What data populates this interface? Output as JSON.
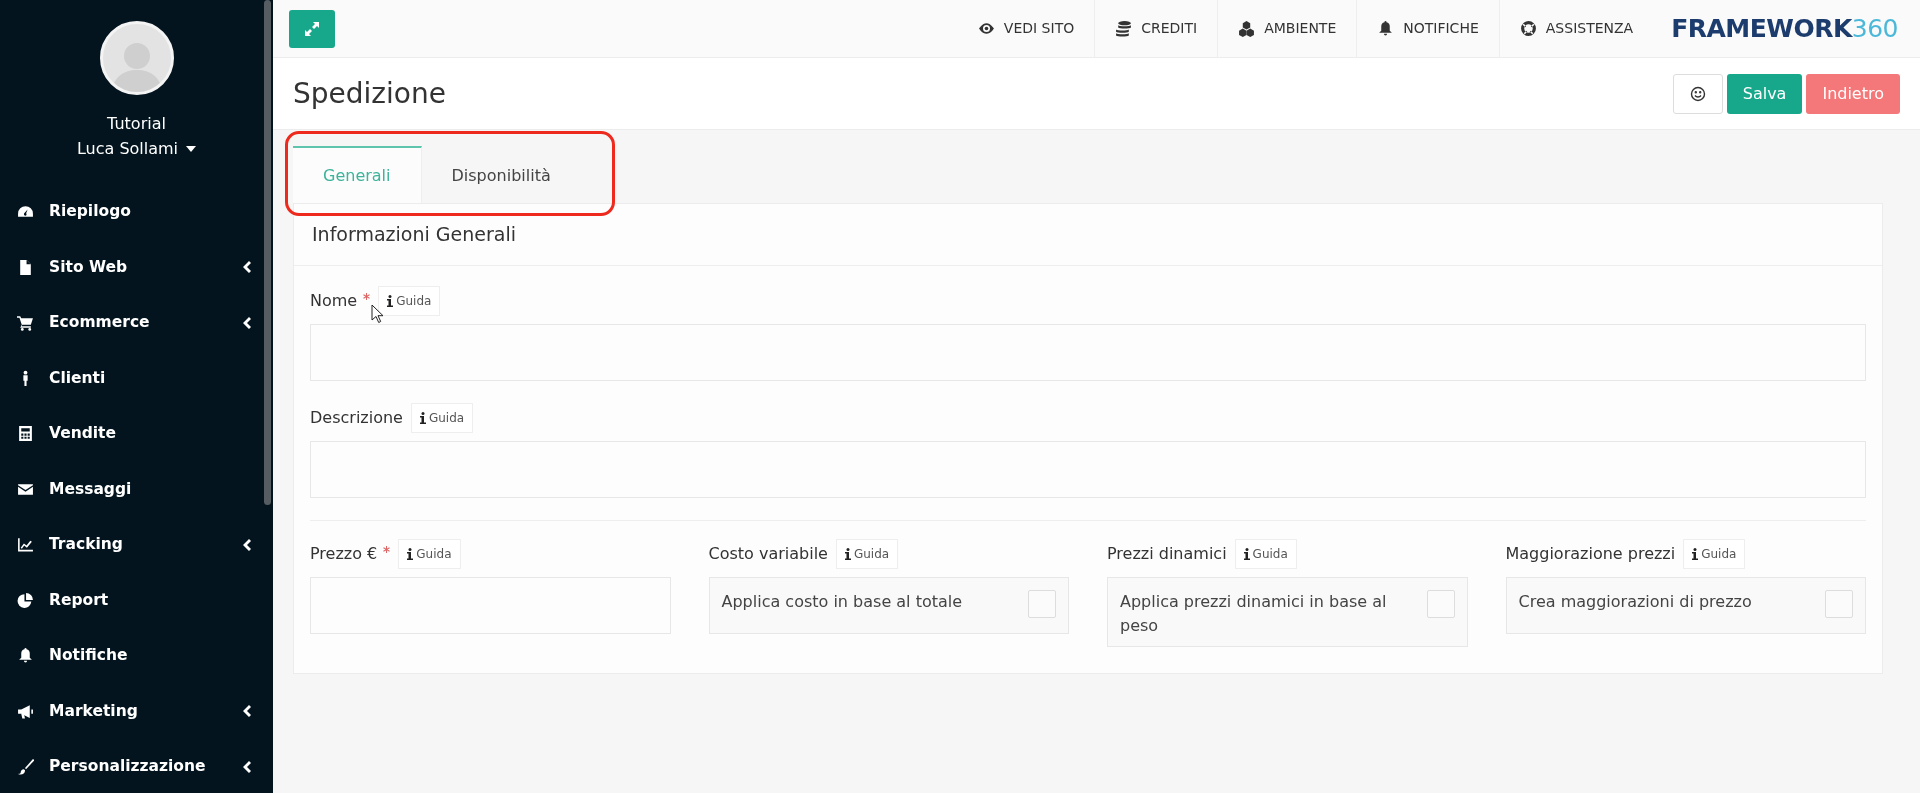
{
  "sidebar": {
    "user": {
      "line_1": "Tutorial",
      "line_2": "Luca Sollami"
    },
    "items": [
      {
        "label": "Riepilogo",
        "has_submenu": false
      },
      {
        "label": "Sito Web",
        "has_submenu": true
      },
      {
        "label": "Ecommerce",
        "has_submenu": true
      },
      {
        "label": "Clienti",
        "has_submenu": false
      },
      {
        "label": "Vendite",
        "has_submenu": false
      },
      {
        "label": "Messaggi",
        "has_submenu": false
      },
      {
        "label": "Tracking",
        "has_submenu": true
      },
      {
        "label": "Report",
        "has_submenu": false
      },
      {
        "label": "Notifiche",
        "has_submenu": false
      },
      {
        "label": "Marketing",
        "has_submenu": true
      },
      {
        "label": "Personalizzazione",
        "has_submenu": true
      }
    ]
  },
  "topbar": {
    "items": [
      {
        "label": "VEDI SITO"
      },
      {
        "label": "CREDITI"
      },
      {
        "label": "AMBIENTE"
      },
      {
        "label": "NOTIFICHE"
      },
      {
        "label": "ASSISTENZA"
      }
    ],
    "logo": {
      "text": "FRAMEWORK",
      "suffix": "360"
    }
  },
  "page": {
    "title": "Spedizione",
    "buttons": [
      {
        "kind": "icon"
      },
      {
        "kind": "primary",
        "label": "Salva"
      },
      {
        "kind": "danger",
        "label": "Indietro"
      }
    ]
  },
  "tabs": [
    {
      "label": "Generali",
      "selected": true
    },
    {
      "label": "Disponibilità",
      "selected": false
    }
  ],
  "card": {
    "title": "Informazioni Generali",
    "fields": [
      {
        "kind": "text",
        "label": "Nome",
        "required": true,
        "help": "Guida"
      },
      {
        "kind": "text",
        "label": "Descrizione",
        "required": false,
        "help": "Guida"
      }
    ],
    "row_fields": [
      {
        "kind": "text",
        "label": "Prezzo €",
        "required": true,
        "help": "Guida"
      },
      {
        "kind": "checkbox",
        "label": "Costo variabile",
        "required": false,
        "help": "Guida",
        "option": "Applica costo in base al totale",
        "checked": false
      },
      {
        "kind": "checkbox",
        "label": "Prezzi dinamici",
        "required": false,
        "help": "Guida",
        "option": "Applica prezzi dinamici in base al peso",
        "checked": false
      },
      {
        "kind": "checkbox",
        "label": "Maggiorazione prezzi",
        "required": false,
        "help": "Guida",
        "option": "Crea maggiorazioni di prezzo",
        "checked": false
      }
    ]
  }
}
